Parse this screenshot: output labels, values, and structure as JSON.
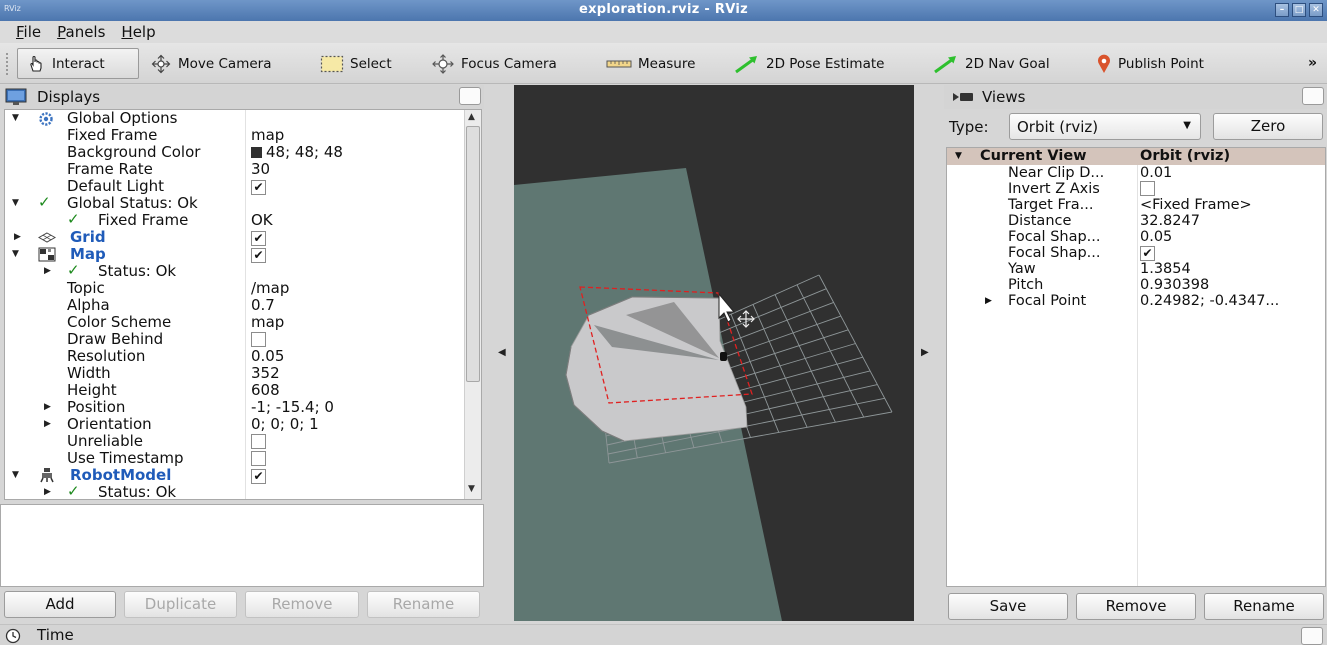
{
  "window": {
    "app_label": "RViz",
    "title": "exploration.rviz - RViz"
  },
  "menubar": [
    {
      "label": "File",
      "u": "F",
      "rest": "ile"
    },
    {
      "label": "Panels",
      "u": "P",
      "rest": "anels"
    },
    {
      "label": "Help",
      "u": "H",
      "rest": "elp"
    }
  ],
  "toolbar": {
    "interact": "Interact",
    "move_camera": "Move Camera",
    "select": "Select",
    "focus_camera": "Focus Camera",
    "measure": "Measure",
    "pose_estimate": "2D Pose Estimate",
    "nav_goal": "2D Nav Goal",
    "publish_point": "Publish Point",
    "more": "»",
    "active_tool": "Interact"
  },
  "displays": {
    "header": "Displays",
    "rows": {
      "global_options": "Global Options",
      "fixed_frame": {
        "name": "Fixed Frame",
        "value": "map"
      },
      "background_color": {
        "name": "Background Color",
        "value": "48; 48; 48",
        "color": "#303030"
      },
      "frame_rate": {
        "name": "Frame Rate",
        "value": "30"
      },
      "default_light": {
        "name": "Default Light",
        "checked": true
      },
      "global_status": "Global Status: Ok",
      "fixed_frame_status": {
        "name": "Fixed Frame",
        "value": "OK"
      },
      "grid": {
        "name": "Grid",
        "checked": true
      },
      "map": {
        "name": "Map",
        "checked": true
      },
      "map_status": "Status: Ok",
      "topic": {
        "name": "Topic",
        "value": "/map"
      },
      "alpha": {
        "name": "Alpha",
        "value": "0.7"
      },
      "color_scheme": {
        "name": "Color Scheme",
        "value": "map"
      },
      "draw_behind": {
        "name": "Draw Behind",
        "checked": false
      },
      "resolution": {
        "name": "Resolution",
        "value": "0.05"
      },
      "width": {
        "name": "Width",
        "value": "352"
      },
      "height": {
        "name": "Height",
        "value": "608"
      },
      "position": {
        "name": "Position",
        "value": "-1; -15.4; 0"
      },
      "orientation": {
        "name": "Orientation",
        "value": "0; 0; 0; 1"
      },
      "unreliable": {
        "name": "Unreliable",
        "checked": false
      },
      "use_timestamp": {
        "name": "Use Timestamp",
        "checked": false
      },
      "robot_model": {
        "name": "RobotModel",
        "checked": true
      },
      "robot_status": "Status: Ok"
    },
    "buttons": {
      "add": "Add",
      "duplicate": "Duplicate",
      "remove": "Remove",
      "rename": "Rename"
    }
  },
  "views": {
    "header": "Views",
    "type_label": "Type:",
    "type_value": "Orbit (rviz)",
    "zero": "Zero",
    "current_view": {
      "name": "Current View",
      "value": "Orbit (rviz)"
    },
    "props": [
      {
        "name": "Near Clip D...",
        "value": "0.01"
      },
      {
        "name": "Invert Z Axis",
        "checkbox": true,
        "checked": false
      },
      {
        "name": "Target Fra...",
        "value": "<Fixed Frame>"
      },
      {
        "name": "Distance",
        "value": "32.8247"
      },
      {
        "name": "Focal Shap...",
        "value": "0.05"
      },
      {
        "name": "Focal Shap...",
        "checkbox": true,
        "checked": true
      },
      {
        "name": "Yaw",
        "value": "1.3854"
      },
      {
        "name": "Pitch",
        "value": "0.930398"
      },
      {
        "name": "Focal Point",
        "value": "0.24982; -0.4347...",
        "expandable": true
      }
    ],
    "buttons": {
      "save": "Save",
      "remove": "Remove",
      "rename": "Rename"
    }
  },
  "time": {
    "header": "Time"
  },
  "colors": {
    "viewport_bg": "#303030",
    "ground_plane": "#5f7772",
    "map_free": "#c9c9cb",
    "selection_box": "#e02020",
    "link_blue": "#1f5bb9",
    "status_green": "#1e8a1e"
  }
}
